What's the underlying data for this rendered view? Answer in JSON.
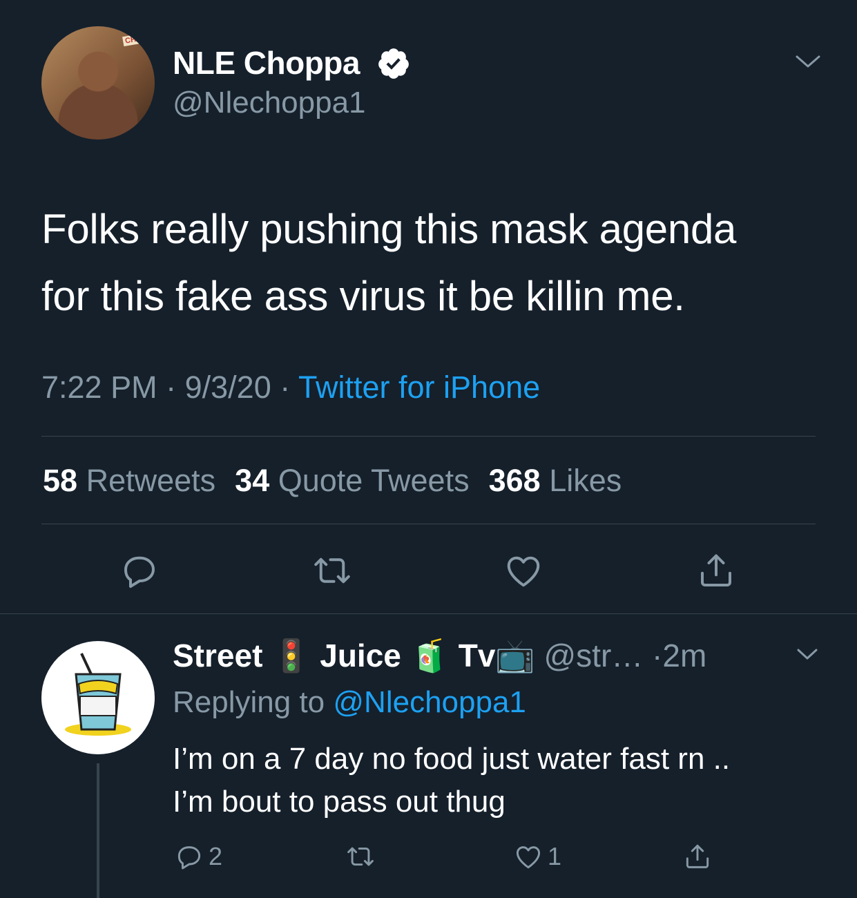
{
  "colors": {
    "background": "#15202b",
    "text": "#ffffff",
    "muted": "#8899a6",
    "link": "#1da1f2",
    "divider": "#38444d"
  },
  "main_tweet": {
    "display_name": "NLE Choppa",
    "verified_icon": "verified-badge-icon",
    "handle": "@Nlechoppa1",
    "text_line1": "Folks really pushing this mask agenda",
    "text_line2": "for this fake ass virus it be killin me.",
    "time": "7:22 PM",
    "date": "9/3/20",
    "separator": "·",
    "source": "Twitter for iPhone",
    "stats": {
      "retweets_count": "58",
      "retweets_label": "Retweets",
      "quotes_count": "34",
      "quotes_label": "Quote Tweets",
      "likes_count": "368",
      "likes_label": "Likes"
    },
    "actions": [
      "reply-icon",
      "retweet-icon",
      "like-icon",
      "share-icon"
    ]
  },
  "reply_tweet": {
    "name_part1": "Street",
    "emoji1": "🚦",
    "name_part2": "Juice",
    "emoji2": "🧃",
    "name_part3": "Tv",
    "emoji3": "📺",
    "handle": "@str…",
    "separator": "·",
    "time": "2m",
    "replying_prefix": "Replying to",
    "replying_mention": "@Nlechoppa1",
    "text_line1": "I’m on a 7 day no food just water fast rn ..",
    "text_line2": "I’m bout to pass out thug",
    "reply_count": "2",
    "like_count": "1"
  }
}
